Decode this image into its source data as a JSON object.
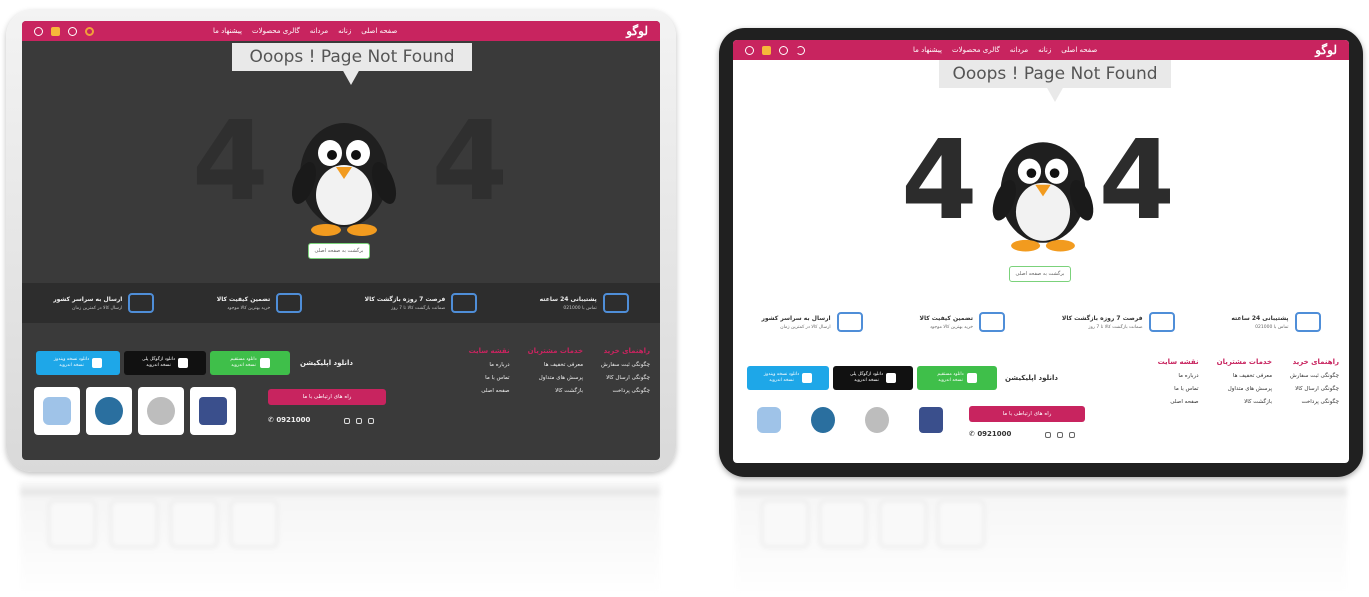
{
  "nav": {
    "logo": "لوگو",
    "items": [
      "صفحه اصلی",
      "زنانه",
      "مردانه",
      "گالری محصولات",
      "پیشنهاد ما"
    ]
  },
  "hero": {
    "bubble_text": "Ooops ! Page  Not Found",
    "big_text_left": "4",
    "big_text_right": "4",
    "home_button": "برگشت به صفحه اصلی"
  },
  "features": [
    {
      "title": "پشتیبانی 24 ساعته",
      "subtitle": "تماس با 021000"
    },
    {
      "title": "فرصت 7 روزه بازگشت کالا",
      "subtitle": "ضمانت بازگشت کالا تا 7 روز"
    },
    {
      "title": "تضمین کیفیت کالا",
      "subtitle": "خرید بهترین کالا موجود"
    },
    {
      "title": "ارسال به سراسر کشور",
      "subtitle": "ارسال کالا در کمترین زمان"
    }
  ],
  "footer": {
    "columns": [
      {
        "heading": "راهنمای خرید",
        "links": [
          "چگونگی ثبت سفارش",
          "چگونگی ارسال کالا",
          "چگونگی پرداخت"
        ]
      },
      {
        "heading": "خدمات مشتریان",
        "links": [
          "معرفی تخفیف ها",
          "پرسش های متداول",
          "بازگشت کالا"
        ]
      },
      {
        "heading": "نقشه سایت",
        "links": [
          "درباره ما",
          "تماس با ما",
          "صفحه اصلی"
        ]
      }
    ],
    "app_title": "دانلود اپلیکیشن",
    "apps": [
      {
        "line1": "دانلود مستقیم",
        "line2": "نسخه اندروید",
        "color": "#3fbf4a"
      },
      {
        "line1": "دانلود ازگوگل پلی",
        "line2": "نسخه اندروید",
        "color": "#111111"
      },
      {
        "line1": "دانلود نسخه ویندوز",
        "line2": "نسخه اندروید",
        "color": "#1ea7e8"
      }
    ],
    "contact_button": "راه های ارتباطی با ما",
    "phone": "0921000"
  },
  "colors": {
    "accent": "#c8245f",
    "dark_bg": "#3a3a3a",
    "light_bg": "#ffffff"
  },
  "icons": [
    "user-icon",
    "cart-icon",
    "search-icon",
    "sun-icon",
    "moon-icon",
    "instagram-icon",
    "telegram-icon",
    "whatsapp-icon"
  ]
}
